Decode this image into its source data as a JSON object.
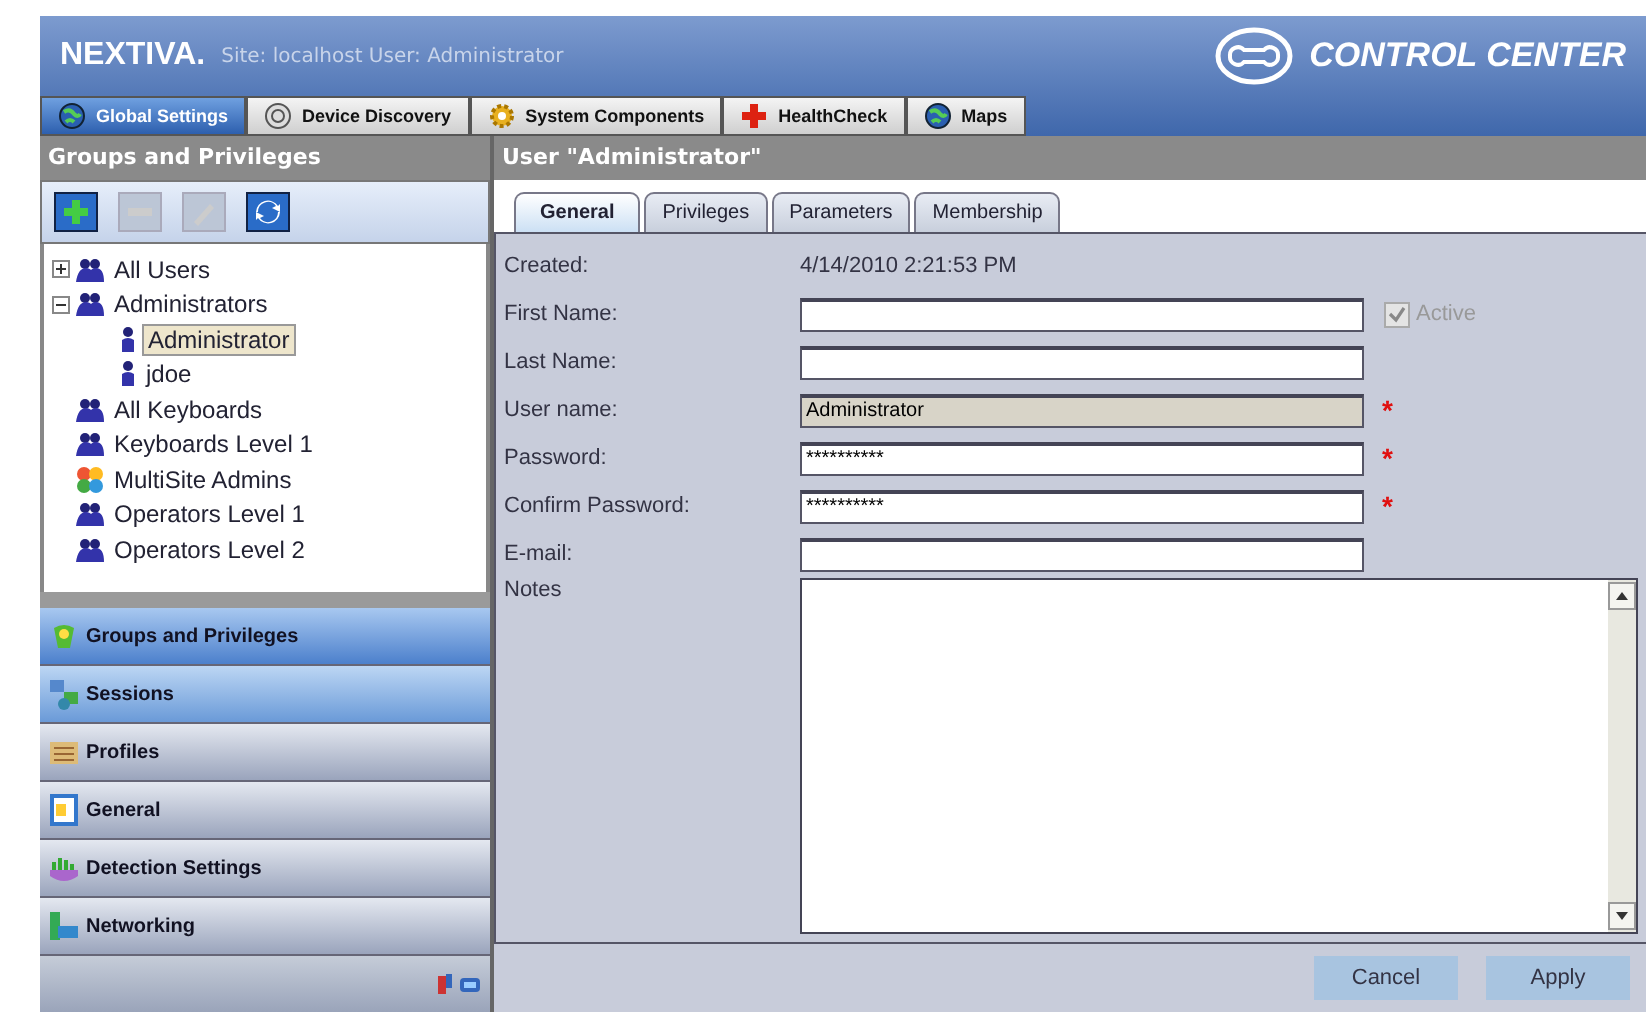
{
  "header": {
    "logo": "NEXTIVA.",
    "subtitle": "Site: localhost User: Administrator",
    "product": "CONTROL CENTER"
  },
  "top_tabs": [
    {
      "label": "Global Settings",
      "selected": true,
      "kind": "globe"
    },
    {
      "label": "Device Discovery",
      "selected": false,
      "kind": "radar"
    },
    {
      "label": "System Components",
      "selected": false,
      "kind": "gear"
    },
    {
      "label": "HealthCheck",
      "selected": false,
      "kind": "cross"
    },
    {
      "label": "Maps",
      "selected": false,
      "kind": "globe"
    }
  ],
  "sidebar": {
    "title": "Groups and Privileges",
    "toolbar": [
      {
        "kind": "add",
        "disabled": false
      },
      {
        "kind": "remove",
        "disabled": true
      },
      {
        "kind": "edit",
        "disabled": true
      },
      {
        "kind": "refresh",
        "disabled": false
      }
    ],
    "tree": [
      {
        "label": "All Users",
        "kind": "group",
        "expanded": false,
        "selected": false
      },
      {
        "label": "Administrators",
        "kind": "group",
        "expanded": true,
        "selected": false,
        "children": [
          {
            "label": "Administrator",
            "kind": "user",
            "selected": true
          },
          {
            "label": "jdoe",
            "kind": "user",
            "selected": false
          }
        ]
      },
      {
        "label": "All Keyboards",
        "kind": "group",
        "selected": false
      },
      {
        "label": "Keyboards Level 1",
        "kind": "group",
        "selected": false
      },
      {
        "label": "MultiSite Admins",
        "kind": "multisite",
        "selected": false
      },
      {
        "label": "Operators Level 1",
        "kind": "group",
        "selected": false
      },
      {
        "label": "Operators Level 2",
        "kind": "group",
        "selected": false
      }
    ],
    "nav": [
      {
        "label": "Groups and Privileges",
        "selected": true,
        "highlighted": true
      },
      {
        "label": "Sessions",
        "selected": false,
        "highlighted": true
      },
      {
        "label": "Profiles",
        "selected": false,
        "highlighted": false
      },
      {
        "label": "General",
        "selected": false,
        "highlighted": false
      },
      {
        "label": "Detection Settings",
        "selected": false,
        "highlighted": false
      },
      {
        "label": "Networking",
        "selected": false,
        "highlighted": false
      }
    ]
  },
  "panel": {
    "title": "User \"Administrator\"",
    "tabs": [
      {
        "label": "General",
        "selected": true
      },
      {
        "label": "Privileges",
        "selected": false
      },
      {
        "label": "Parameters",
        "selected": false
      },
      {
        "label": "Membership",
        "selected": false
      }
    ],
    "created_label": "Created:",
    "created_value": "4/14/2010 2:21:53 PM",
    "fields": [
      {
        "label": "First Name:",
        "disabled": false,
        "required": false
      },
      {
        "label": "Last Name:",
        "disabled": false,
        "required": false
      },
      {
        "label": "User name:",
        "value": "Administrator",
        "disabled": true,
        "required": true
      },
      {
        "label": "Password:",
        "value": "**********",
        "disabled": false,
        "required": true
      },
      {
        "label": "Confirm Password:",
        "value": "**********",
        "disabled": false,
        "required": true
      },
      {
        "label": "E-mail:",
        "disabled": false,
        "required": false
      }
    ],
    "active": {
      "label": "Active",
      "checked": true,
      "disabled": true
    },
    "required_mark": "*",
    "notes_label": "Notes",
    "buttons": [
      "Cancel",
      "Apply"
    ]
  }
}
